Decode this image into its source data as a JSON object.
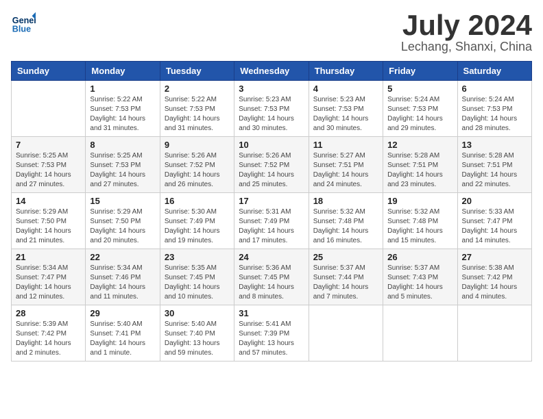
{
  "header": {
    "logo_line1": "General",
    "logo_line2": "Blue",
    "month": "July 2024",
    "location": "Lechang, Shanxi, China"
  },
  "weekdays": [
    "Sunday",
    "Monday",
    "Tuesday",
    "Wednesday",
    "Thursday",
    "Friday",
    "Saturday"
  ],
  "weeks": [
    [
      {
        "day": "",
        "sunrise": "",
        "sunset": "",
        "daylight": ""
      },
      {
        "day": "1",
        "sunrise": "Sunrise: 5:22 AM",
        "sunset": "Sunset: 7:53 PM",
        "daylight": "Daylight: 14 hours and 31 minutes."
      },
      {
        "day": "2",
        "sunrise": "Sunrise: 5:22 AM",
        "sunset": "Sunset: 7:53 PM",
        "daylight": "Daylight: 14 hours and 31 minutes."
      },
      {
        "day": "3",
        "sunrise": "Sunrise: 5:23 AM",
        "sunset": "Sunset: 7:53 PM",
        "daylight": "Daylight: 14 hours and 30 minutes."
      },
      {
        "day": "4",
        "sunrise": "Sunrise: 5:23 AM",
        "sunset": "Sunset: 7:53 PM",
        "daylight": "Daylight: 14 hours and 30 minutes."
      },
      {
        "day": "5",
        "sunrise": "Sunrise: 5:24 AM",
        "sunset": "Sunset: 7:53 PM",
        "daylight": "Daylight: 14 hours and 29 minutes."
      },
      {
        "day": "6",
        "sunrise": "Sunrise: 5:24 AM",
        "sunset": "Sunset: 7:53 PM",
        "daylight": "Daylight: 14 hours and 28 minutes."
      }
    ],
    [
      {
        "day": "7",
        "sunrise": "Sunrise: 5:25 AM",
        "sunset": "Sunset: 7:53 PM",
        "daylight": "Daylight: 14 hours and 27 minutes."
      },
      {
        "day": "8",
        "sunrise": "Sunrise: 5:25 AM",
        "sunset": "Sunset: 7:53 PM",
        "daylight": "Daylight: 14 hours and 27 minutes."
      },
      {
        "day": "9",
        "sunrise": "Sunrise: 5:26 AM",
        "sunset": "Sunset: 7:52 PM",
        "daylight": "Daylight: 14 hours and 26 minutes."
      },
      {
        "day": "10",
        "sunrise": "Sunrise: 5:26 AM",
        "sunset": "Sunset: 7:52 PM",
        "daylight": "Daylight: 14 hours and 25 minutes."
      },
      {
        "day": "11",
        "sunrise": "Sunrise: 5:27 AM",
        "sunset": "Sunset: 7:51 PM",
        "daylight": "Daylight: 14 hours and 24 minutes."
      },
      {
        "day": "12",
        "sunrise": "Sunrise: 5:28 AM",
        "sunset": "Sunset: 7:51 PM",
        "daylight": "Daylight: 14 hours and 23 minutes."
      },
      {
        "day": "13",
        "sunrise": "Sunrise: 5:28 AM",
        "sunset": "Sunset: 7:51 PM",
        "daylight": "Daylight: 14 hours and 22 minutes."
      }
    ],
    [
      {
        "day": "14",
        "sunrise": "Sunrise: 5:29 AM",
        "sunset": "Sunset: 7:50 PM",
        "daylight": "Daylight: 14 hours and 21 minutes."
      },
      {
        "day": "15",
        "sunrise": "Sunrise: 5:29 AM",
        "sunset": "Sunset: 7:50 PM",
        "daylight": "Daylight: 14 hours and 20 minutes."
      },
      {
        "day": "16",
        "sunrise": "Sunrise: 5:30 AM",
        "sunset": "Sunset: 7:49 PM",
        "daylight": "Daylight: 14 hours and 19 minutes."
      },
      {
        "day": "17",
        "sunrise": "Sunrise: 5:31 AM",
        "sunset": "Sunset: 7:49 PM",
        "daylight": "Daylight: 14 hours and 17 minutes."
      },
      {
        "day": "18",
        "sunrise": "Sunrise: 5:32 AM",
        "sunset": "Sunset: 7:48 PM",
        "daylight": "Daylight: 14 hours and 16 minutes."
      },
      {
        "day": "19",
        "sunrise": "Sunrise: 5:32 AM",
        "sunset": "Sunset: 7:48 PM",
        "daylight": "Daylight: 14 hours and 15 minutes."
      },
      {
        "day": "20",
        "sunrise": "Sunrise: 5:33 AM",
        "sunset": "Sunset: 7:47 PM",
        "daylight": "Daylight: 14 hours and 14 minutes."
      }
    ],
    [
      {
        "day": "21",
        "sunrise": "Sunrise: 5:34 AM",
        "sunset": "Sunset: 7:47 PM",
        "daylight": "Daylight: 14 hours and 12 minutes."
      },
      {
        "day": "22",
        "sunrise": "Sunrise: 5:34 AM",
        "sunset": "Sunset: 7:46 PM",
        "daylight": "Daylight: 14 hours and 11 minutes."
      },
      {
        "day": "23",
        "sunrise": "Sunrise: 5:35 AM",
        "sunset": "Sunset: 7:45 PM",
        "daylight": "Daylight: 14 hours and 10 minutes."
      },
      {
        "day": "24",
        "sunrise": "Sunrise: 5:36 AM",
        "sunset": "Sunset: 7:45 PM",
        "daylight": "Daylight: 14 hours and 8 minutes."
      },
      {
        "day": "25",
        "sunrise": "Sunrise: 5:37 AM",
        "sunset": "Sunset: 7:44 PM",
        "daylight": "Daylight: 14 hours and 7 minutes."
      },
      {
        "day": "26",
        "sunrise": "Sunrise: 5:37 AM",
        "sunset": "Sunset: 7:43 PM",
        "daylight": "Daylight: 14 hours and 5 minutes."
      },
      {
        "day": "27",
        "sunrise": "Sunrise: 5:38 AM",
        "sunset": "Sunset: 7:42 PM",
        "daylight": "Daylight: 14 hours and 4 minutes."
      }
    ],
    [
      {
        "day": "28",
        "sunrise": "Sunrise: 5:39 AM",
        "sunset": "Sunset: 7:42 PM",
        "daylight": "Daylight: 14 hours and 2 minutes."
      },
      {
        "day": "29",
        "sunrise": "Sunrise: 5:40 AM",
        "sunset": "Sunset: 7:41 PM",
        "daylight": "Daylight: 14 hours and 1 minute."
      },
      {
        "day": "30",
        "sunrise": "Sunrise: 5:40 AM",
        "sunset": "Sunset: 7:40 PM",
        "daylight": "Daylight: 13 hours and 59 minutes."
      },
      {
        "day": "31",
        "sunrise": "Sunrise: 5:41 AM",
        "sunset": "Sunset: 7:39 PM",
        "daylight": "Daylight: 13 hours and 57 minutes."
      },
      {
        "day": "",
        "sunrise": "",
        "sunset": "",
        "daylight": ""
      },
      {
        "day": "",
        "sunrise": "",
        "sunset": "",
        "daylight": ""
      },
      {
        "day": "",
        "sunrise": "",
        "sunset": "",
        "daylight": ""
      }
    ]
  ]
}
